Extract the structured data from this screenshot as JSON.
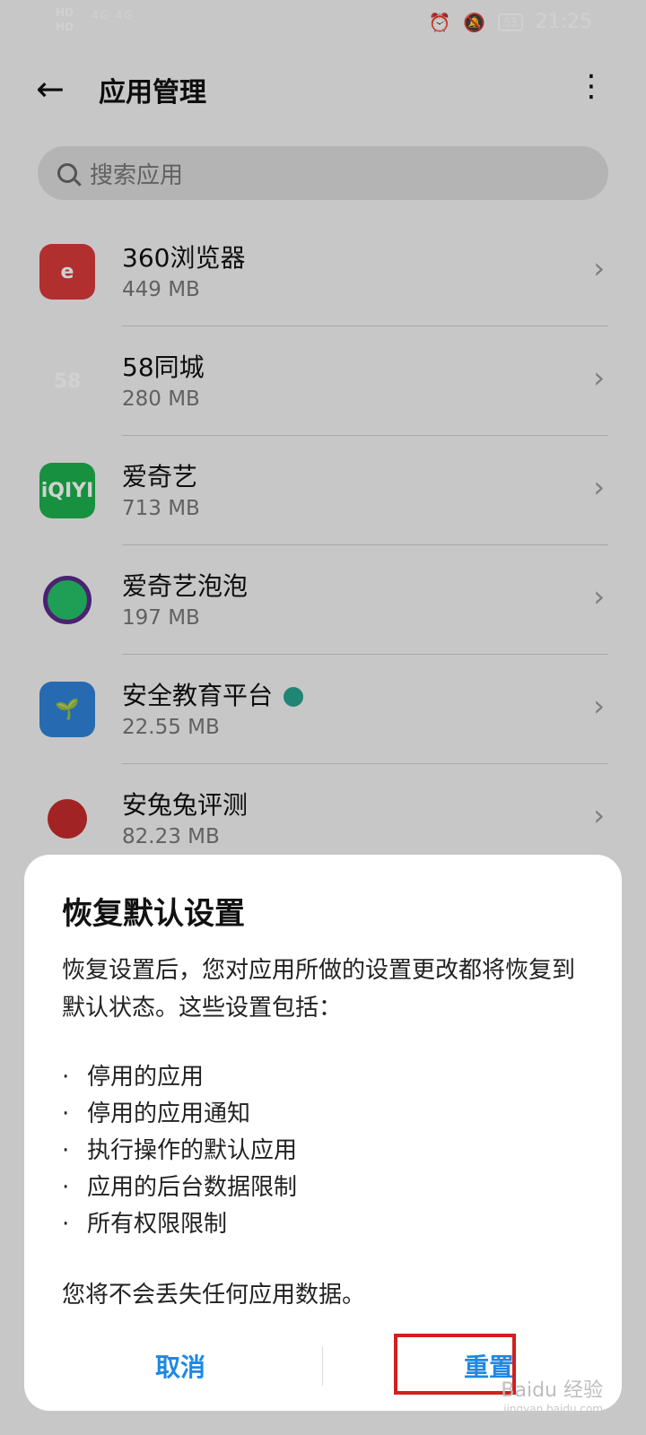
{
  "status_bar": {
    "hd_top": "HD",
    "hd_bottom": "HD",
    "signal": "4G 4G",
    "battery": "53",
    "time": "21:25"
  },
  "header": {
    "title": "应用管理"
  },
  "search": {
    "placeholder": "搜索应用"
  },
  "apps": [
    {
      "name": "360浏览器",
      "size": "449 MB",
      "icon": "360-browser-icon"
    },
    {
      "name": "58同城",
      "size": "280 MB",
      "icon": "58-tongcheng-icon"
    },
    {
      "name": "爱奇艺",
      "size": "713 MB",
      "icon": "iqiyi-icon"
    },
    {
      "name": "爱奇艺泡泡",
      "size": "197 MB",
      "icon": "iqiyi-paopao-icon"
    },
    {
      "name": "安全教育平台",
      "size": "22.55 MB",
      "icon": "safety-education-icon"
    },
    {
      "name": "安兔兔评测",
      "size": "82.23 MB",
      "icon": "antutu-icon"
    }
  ],
  "dialog": {
    "title": "恢复默认设置",
    "body": "恢复设置后，您对应用所做的设置更改都将恢复到默认状态。这些设置包括：",
    "items": [
      "停用的应用",
      "停用的应用通知",
      "执行操作的默认应用",
      "应用的后台数据限制",
      "所有权限限制"
    ],
    "footer": "您将不会丢失任何应用数据。",
    "cancel_label": "取消",
    "reset_label": "重置"
  },
  "icons": {
    "360": "e",
    "58": "58",
    "iqiyi": "iQIYI"
  },
  "watermark": {
    "text": "Baidu 经验",
    "sub": "jingyan.baidu.com"
  },
  "colors": {
    "accent": "#1e88e5",
    "highlight": "#d31f1f"
  }
}
